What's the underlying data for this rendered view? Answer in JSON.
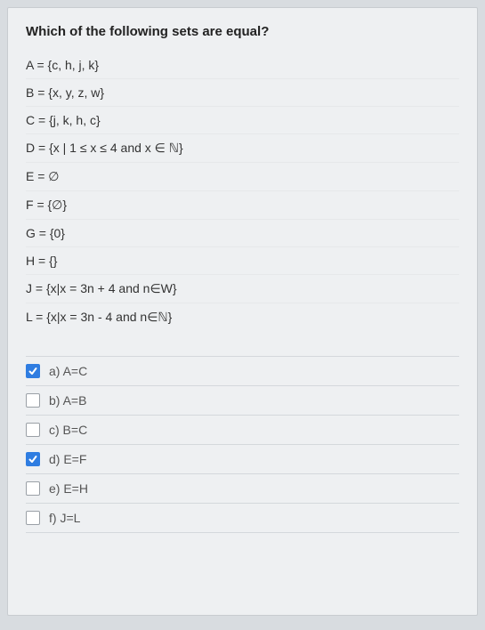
{
  "question": "Which of the following sets are equal?",
  "statements": [
    "A = {c, h, j, k}",
    "B = {x, y, z, w}",
    "C = {j, k, h, c}",
    "D = {x | 1 ≤ x ≤ 4 and x ∈ ℕ}",
    "E = ∅",
    "F = {∅}",
    "G = {0}",
    "H = {}",
    "J = {x|x = 3n + 4 and n∈W}",
    "L = {x|x = 3n - 4 and n∈ℕ}"
  ],
  "options": [
    {
      "id": "a",
      "label": "a) A=C",
      "checked": true
    },
    {
      "id": "b",
      "label": "b) A=B",
      "checked": false
    },
    {
      "id": "c",
      "label": "c) B=C",
      "checked": false
    },
    {
      "id": "d",
      "label": "d) E=F",
      "checked": true
    },
    {
      "id": "e",
      "label": "e) E=H",
      "checked": false
    },
    {
      "id": "f",
      "label": "f) J=L",
      "checked": false
    }
  ]
}
